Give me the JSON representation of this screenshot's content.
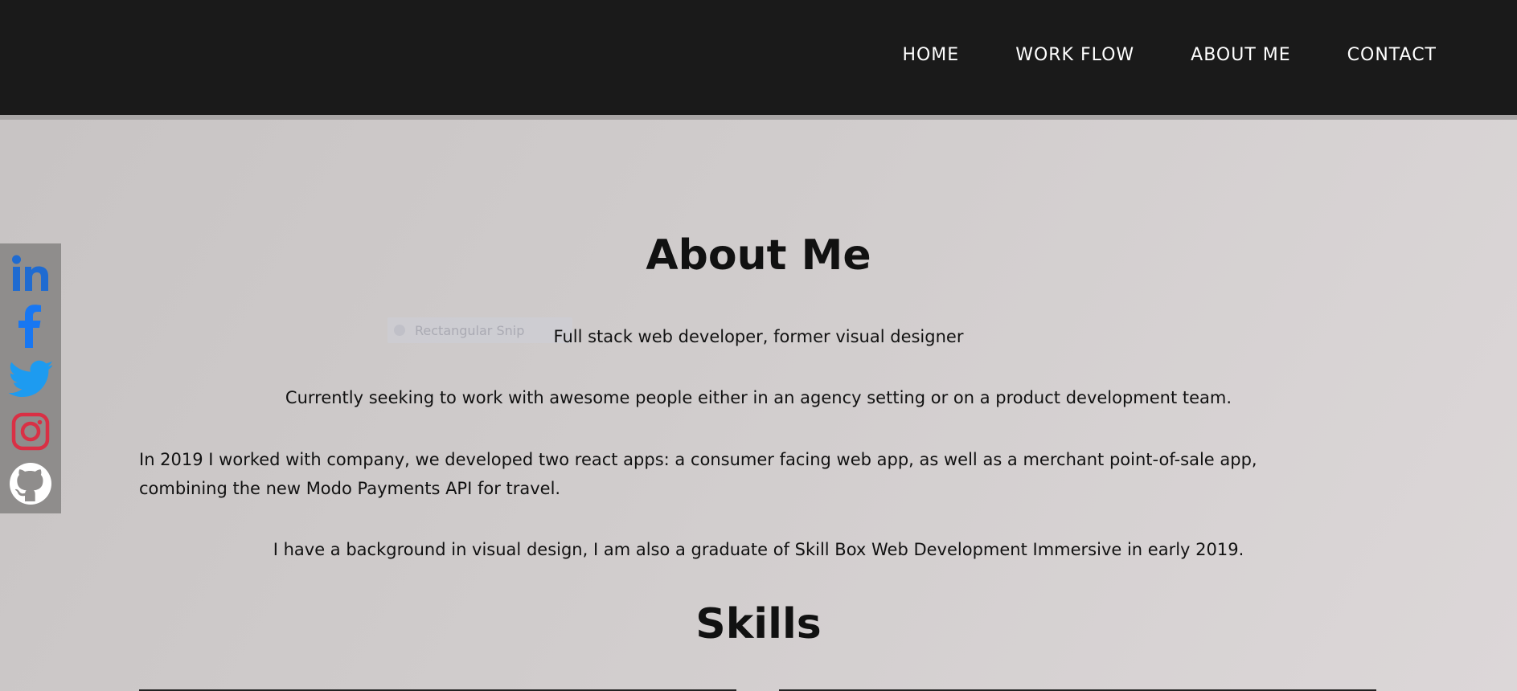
{
  "nav": {
    "links": [
      "HOME",
      "WORK FLOW",
      "ABOUT ME",
      "CONTACT"
    ]
  },
  "social": {
    "icons": [
      "linkedin-icon",
      "facebook-icon",
      "twitter-icon",
      "instagram-icon",
      "github-icon"
    ],
    "colors": {
      "linkedin": "#1f6bd1",
      "facebook": "#1877f2",
      "twitter": "#1d9bf0",
      "instagram": "#d93045",
      "github": "#ffffff",
      "bar": "#8f8d8c"
    }
  },
  "about": {
    "title": "About Me",
    "tagline": "Full stack web developer, former visual designer",
    "seeking": "Currently seeking to work with awesome people either in an agency setting or on a product development team.",
    "experience_line1": "In 2019 I worked with company, we developed two react apps: a consumer facing web app, as well as a merchant point-of-sale app,",
    "experience_line2": "combining the new Modo Payments API for travel.",
    "background": "I have a background in visual design, I am also a graduate of Skill Box Web Development Immersive in early 2019."
  },
  "snip_overlay": {
    "label": "Rectangular Snip"
  },
  "skills": {
    "title": "Skills"
  }
}
